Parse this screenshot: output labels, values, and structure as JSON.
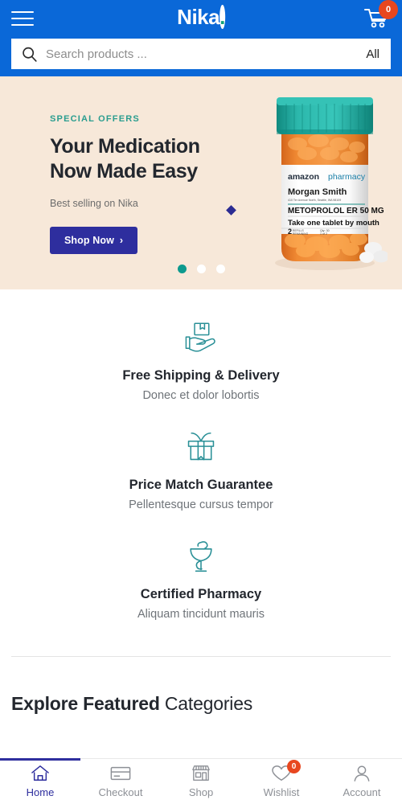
{
  "header": {
    "menu_icon": "hamburger-menu-icon",
    "logo_text": "Nika",
    "logo_dot": ".",
    "cart_icon": "shopping-cart-icon",
    "cart_count": "0",
    "search": {
      "icon": "search-icon",
      "placeholder": "Search products ...",
      "value": "",
      "scope_label": "All"
    },
    "colors": {
      "background": "#0a68d8",
      "logo_dot": "#12a37a",
      "badge": "#e8471f"
    }
  },
  "hero": {
    "eyebrow": "SPECIAL OFFERS",
    "title_line1": "Your Medication",
    "title_line2": "Now Made Easy",
    "subtitle": "Best selling on Nika",
    "cta_label": "Shop Now",
    "cta_chevron": "›",
    "product_image": {
      "alt": "prescription-pill-bottle",
      "brand_line1": "amazon",
      "brand_line2": "pharmacy",
      "patient": "Morgan Smith",
      "address": "410 Ter Avenue North, Seattle, WA 98109",
      "drug": "METOPROLOL ER 50 MG",
      "directions": "Take one tablet by mouth",
      "refills_number": "2",
      "refills_label1": "REFILLS",
      "refills_label2": "REMAINING",
      "qty_label": "Qty: 30",
      "fill_label": "1 of 2"
    },
    "carousel": {
      "slides": 3,
      "active_index": 0
    },
    "colors": {
      "background": "#f7e8d9",
      "eyebrow": "#2a9d8f",
      "title": "#23272e",
      "cta_bg": "#2e2e9e",
      "dot_active": "#0d9a8e",
      "diamond_navy": "#2b2b92",
      "diamond_tan": "#e3cfb8",
      "diamond_teal": "#0d9a8e"
    }
  },
  "features": {
    "icon_color": "#2a9097",
    "items": [
      {
        "icon": "hand-holding-package-icon",
        "title": "Free Shipping & Delivery",
        "subtitle": "Donec et dolor lobortis"
      },
      {
        "icon": "gift-box-icon",
        "title": "Price Match Guarantee",
        "subtitle": "Pellentesque cursus tempor"
      },
      {
        "icon": "bowl-of-hygieia-pharmacy-icon",
        "title": "Certified Pharmacy",
        "subtitle": "Aliquam tincidunt mauris"
      }
    ]
  },
  "section": {
    "heading_bold": "Explore Featured",
    "heading_light": " Categories"
  },
  "bottom_nav": {
    "active_color": "#2e2e9e",
    "inactive_color": "#8d9096",
    "items": [
      {
        "icon": "home-icon",
        "label": "Home",
        "active": true,
        "badge": null
      },
      {
        "icon": "credit-card-icon",
        "label": "Checkout",
        "active": false,
        "badge": null
      },
      {
        "icon": "store-icon",
        "label": "Shop",
        "active": false,
        "badge": null
      },
      {
        "icon": "heart-icon",
        "label": "Wishlist",
        "active": false,
        "badge": "0"
      },
      {
        "icon": "user-icon",
        "label": "Account",
        "active": false,
        "badge": null
      }
    ]
  }
}
